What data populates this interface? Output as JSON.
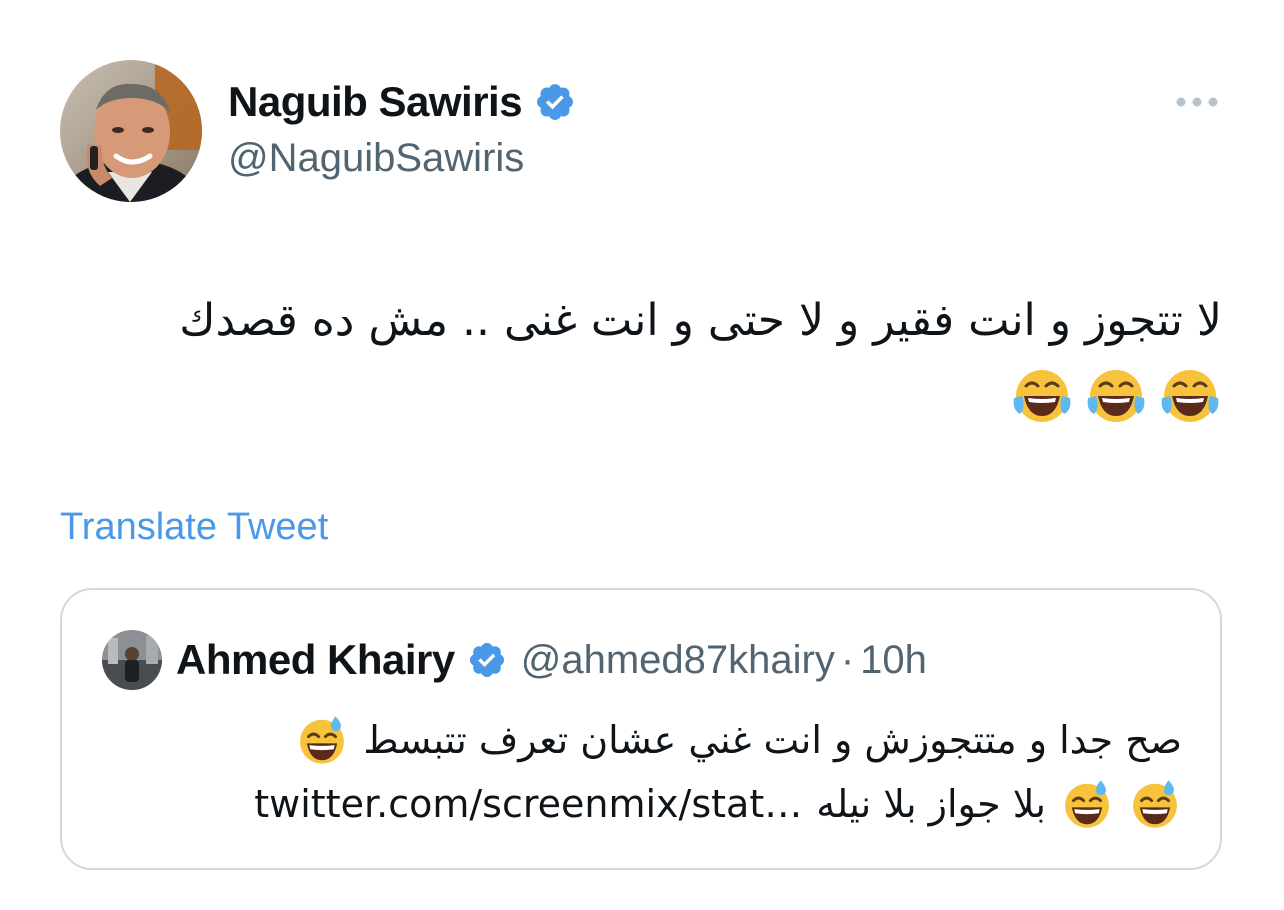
{
  "tweet": {
    "author": {
      "display_name": "Naguib Sawiris",
      "handle": "@NaguibSawiris",
      "verified_icon": "verified-badge-icon",
      "avatar": "avatar-photo"
    },
    "more_icon": "more-options-icon",
    "text": "لا تتجوز و انت فقير و لا حتى و انت غنى .. مش ده قصدك",
    "emojis": [
      "😂",
      "😂",
      "😂"
    ],
    "translate_label": "Translate Tweet"
  },
  "quote": {
    "author": {
      "display_name": "Ahmed Khairy",
      "handle": "@ahmed87khairy",
      "separator": "·",
      "time": "10h",
      "verified_icon": "verified-badge-icon"
    },
    "line1": "صح جدا و متتجوزش و انت غني عشان تعرف تتبسط",
    "line1_emoji": "😅",
    "line2_text": "بلا جواز بلا نيله",
    "line2_emojis": [
      "😅",
      "😅"
    ],
    "line2_link": "twitter.com/screenmix/stat…"
  },
  "colors": {
    "text": "#0f1419",
    "secondary": "#536471",
    "link": "#4a99e9",
    "verified": "#4a99e9",
    "border": "#cfd9de"
  }
}
